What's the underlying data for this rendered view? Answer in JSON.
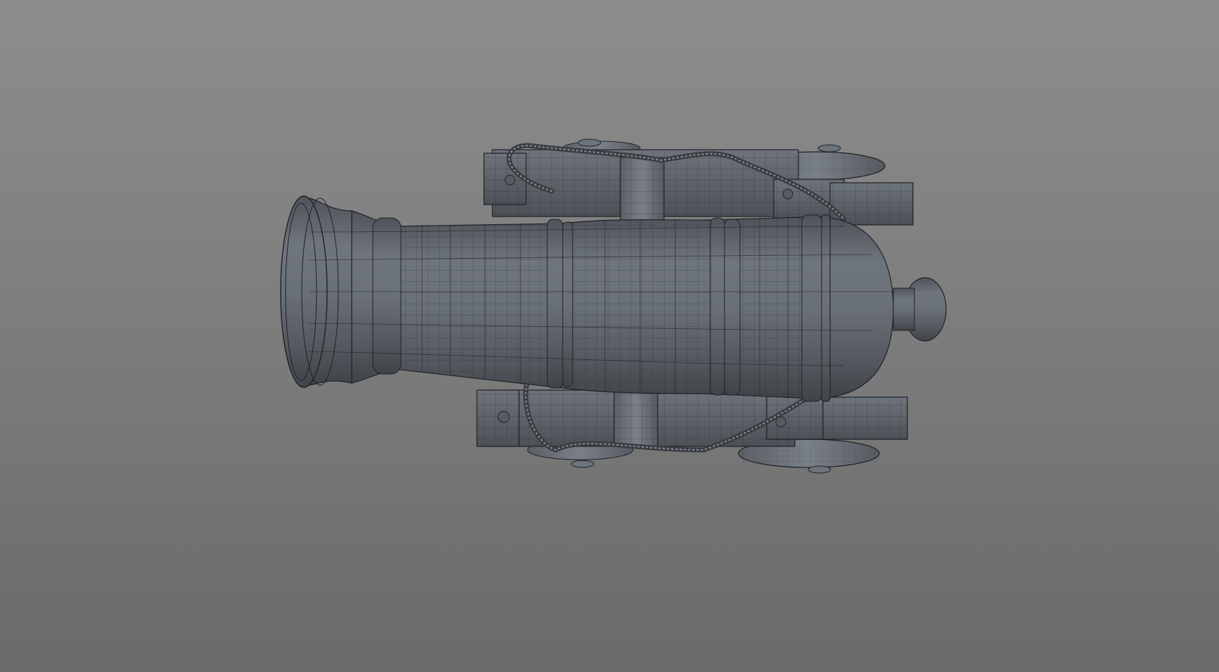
{
  "viewport": {
    "background_top": "#8d8d8d",
    "background_bottom": "#6a6a6a"
  },
  "model": {
    "object": "cannon",
    "display_mode": "shaded-wireframe",
    "view": "top",
    "mesh_color": "#5f646b",
    "mesh_light": "#7d838a",
    "mesh_dark": "#3f4449",
    "wire_color": "#1f2226"
  }
}
